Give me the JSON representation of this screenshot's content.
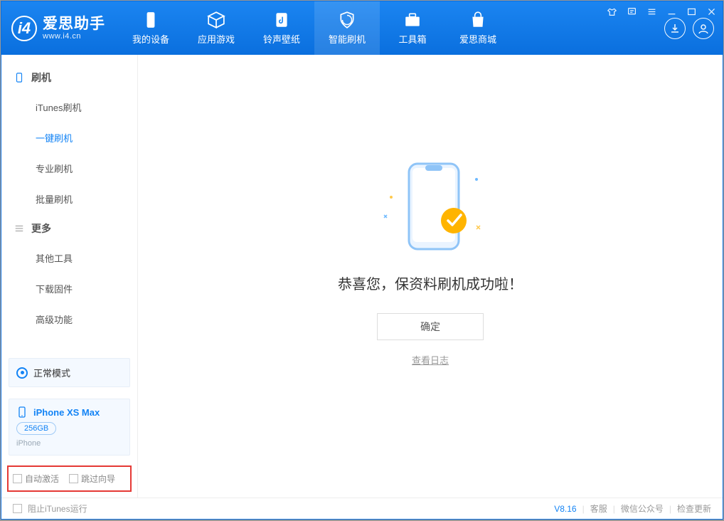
{
  "app": {
    "title": "爱思助手",
    "subtitle": "www.i4.cn"
  },
  "nav": {
    "device": "我的设备",
    "apps": "应用游戏",
    "ringtone": "铃声壁纸",
    "flash": "智能刷机",
    "toolbox": "工具箱",
    "store": "爱思商城"
  },
  "sidebar": {
    "group1": "刷机",
    "items1": {
      "itunes": "iTunes刷机",
      "onekey": "一键刷机",
      "pro": "专业刷机",
      "batch": "批量刷机"
    },
    "group2": "更多",
    "items2": {
      "other": "其他工具",
      "download": "下载固件",
      "advanced": "高级功能"
    }
  },
  "mode": {
    "label": "正常模式"
  },
  "device": {
    "name": "iPhone XS Max",
    "capacity": "256GB",
    "type": "iPhone"
  },
  "options": {
    "auto_activate": "自动激活",
    "skip_guide": "跳过向导"
  },
  "main": {
    "success": "恭喜您，保资料刷机成功啦！",
    "ok": "确定",
    "view_log": "查看日志"
  },
  "footer": {
    "block_itunes": "阻止iTunes运行",
    "version": "V8.16",
    "support": "客服",
    "wechat": "微信公众号",
    "update": "检查更新"
  }
}
